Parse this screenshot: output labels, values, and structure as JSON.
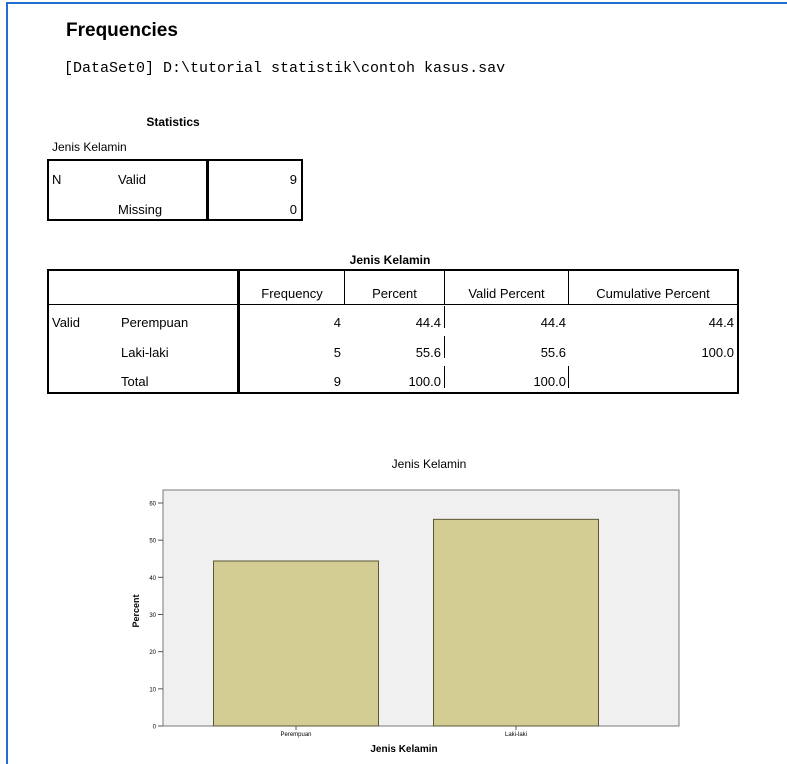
{
  "header": {
    "title": "Frequencies",
    "dataset": "[DataSet0] D:\\tutorial statistik\\contoh kasus.sav"
  },
  "statistics_table": {
    "title": "Statistics",
    "variable": "Jenis Kelamin",
    "row_stub": "N",
    "rows": [
      {
        "label": "Valid",
        "value": "9"
      },
      {
        "label": "Missing",
        "value": "0"
      }
    ]
  },
  "frequency_table": {
    "title": "Jenis Kelamin",
    "columns": [
      "Frequency",
      "Percent",
      "Valid Percent",
      "Cumulative Percent"
    ],
    "row_stub": "Valid",
    "rows": [
      {
        "label": "Perempuan",
        "frequency": "4",
        "percent": "44.4",
        "valid_percent": "44.4",
        "cumulative_percent": "44.4"
      },
      {
        "label": "Laki-laki",
        "frequency": "5",
        "percent": "55.6",
        "valid_percent": "55.6",
        "cumulative_percent": "100.0"
      },
      {
        "label": "Total",
        "frequency": "9",
        "percent": "100.0",
        "valid_percent": "100.0",
        "cumulative_percent": ""
      }
    ]
  },
  "chart_data": {
    "type": "bar",
    "title": "Jenis Kelamin",
    "xlabel": "Jenis Kelamin",
    "ylabel": "Percent",
    "categories": [
      "Perempuan",
      "Laki-laki"
    ],
    "values": [
      44.4,
      55.6
    ],
    "ylim": [
      0,
      60
    ],
    "yticks": [
      0,
      10,
      20,
      30,
      40,
      50,
      60
    ],
    "grid": false,
    "colors": {
      "bar": "#d3cd94",
      "bar_stroke": "#5a5636",
      "plot_bg": "#f0f0f0"
    }
  }
}
